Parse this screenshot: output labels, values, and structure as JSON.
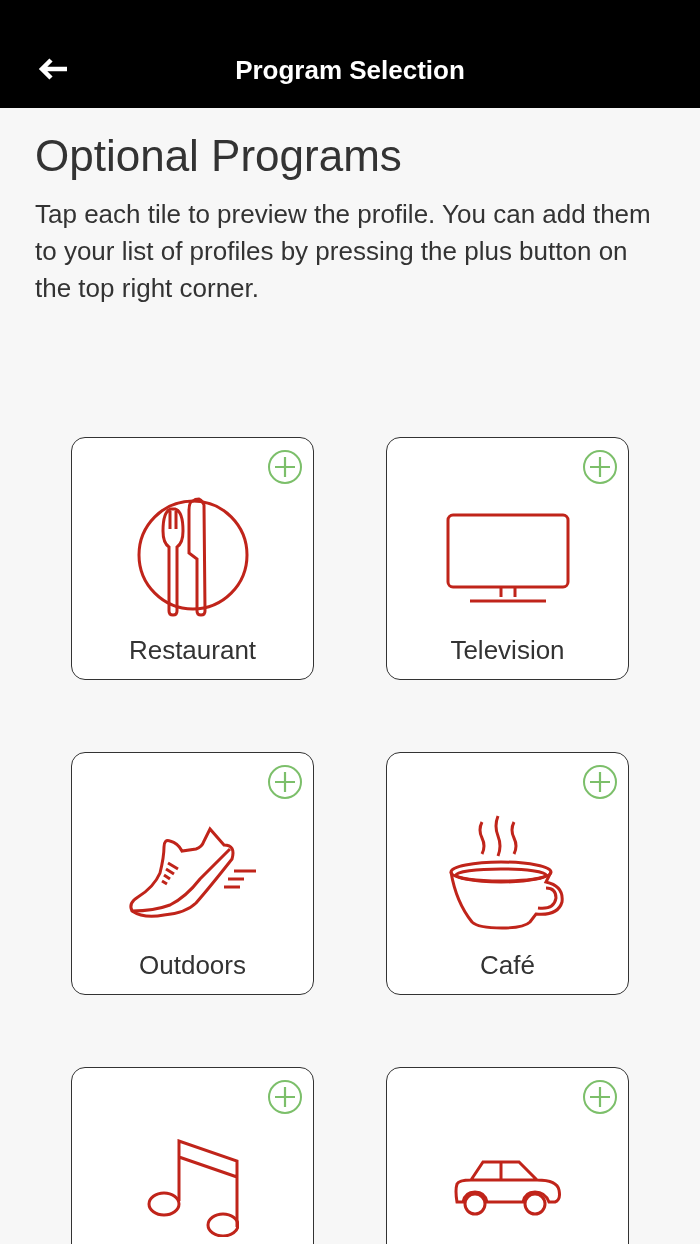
{
  "header": {
    "title": "Program Selection"
  },
  "heading": "Optional Programs",
  "description": "Tap each tile to preview the profile. You can add them to your list of profiles by pressing the plus button on the top right corner.",
  "tiles": [
    {
      "kind": "restaurant",
      "label": "Restaurant"
    },
    {
      "kind": "television",
      "label": "Television"
    },
    {
      "kind": "outdoors",
      "label": "Outdoors"
    },
    {
      "kind": "cafe",
      "label": "Café"
    },
    {
      "kind": "music"
    },
    {
      "kind": "car"
    }
  ]
}
